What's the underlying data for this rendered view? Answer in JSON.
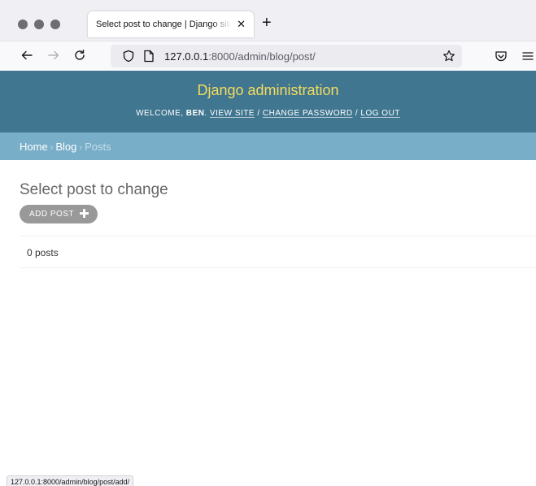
{
  "browser": {
    "tab_title": "Select post to change | Django site admin",
    "tab_close": "✕",
    "new_tab": "+",
    "url_host": "127.0.0.1",
    "url_rest": ":8000/admin/blog/post/",
    "status_url": "127.0.0.1:8000/admin/blog/post/add/"
  },
  "header": {
    "site_name": "Django administration",
    "welcome": "Welcome, ",
    "username": "Ben",
    "view_site": "View site",
    "change_password": "Change password",
    "log_out": "Log out",
    "sep_dot": ". ",
    "sep_slash": " / "
  },
  "breadcrumbs": {
    "home": "Home",
    "app": "Blog",
    "current": "Posts",
    "sep": "›"
  },
  "content": {
    "title": "Select post to change",
    "add_label": "ADD POST",
    "add_icon": "✚",
    "result_count": "0 posts"
  },
  "colors": {
    "header_bg": "#417690",
    "branding": "#f5dd5d",
    "breadcrumb_bg": "#79aec8",
    "button_bg": "#999999"
  }
}
